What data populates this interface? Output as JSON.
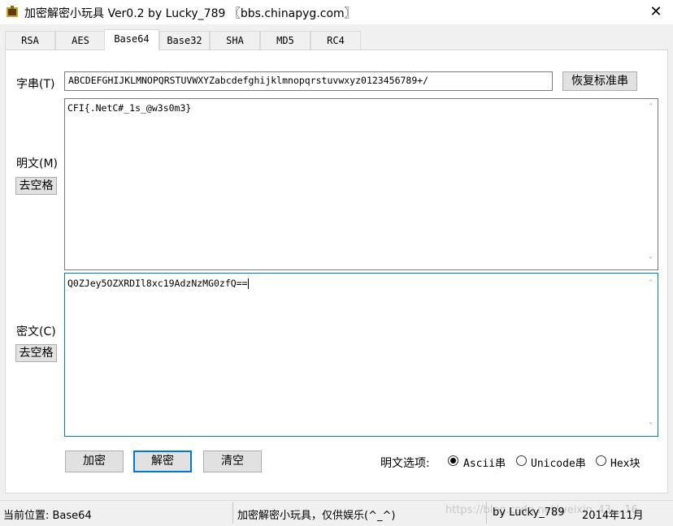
{
  "window": {
    "title": "加密解密小玩具 Ver0.2 by Lucky_789 〖bbs.chinapyg.com〗",
    "close_glyph": "✕"
  },
  "tabs": [
    {
      "label": "RSA"
    },
    {
      "label": "AES"
    },
    {
      "label": "Base64",
      "active": true
    },
    {
      "label": "Base32"
    },
    {
      "label": "SHA"
    },
    {
      "label": "MD5"
    },
    {
      "label": "RC4"
    }
  ],
  "charset": {
    "label": "字串(T)",
    "value": "ABCDEFGHIJKLMNOPQRSTUVWXYZabcdefghijklmnopqrstuvwxyz0123456789+/",
    "restore_button": "恢复标准串"
  },
  "plaintext": {
    "label": "明文(M)",
    "strip_button": "去空格",
    "value": "CFI{.NetC#_1s_@w3s0m3}"
  },
  "ciphertext": {
    "label": "密文(C)",
    "strip_button": "去空格",
    "value": "Q0ZJey5OZXRDIl8xc19AdzNzMG0zfQ=="
  },
  "actions": {
    "encrypt": "加密",
    "decrypt": "解密",
    "clear": "清空"
  },
  "options": {
    "label": "明文选项:",
    "items": [
      "Ascii串",
      "Unicode串",
      "Hex块"
    ],
    "selected": "Ascii串"
  },
  "status": {
    "position": "当前位置: Base64",
    "message": "加密解密小玩具，仅供娱乐(^_^)",
    "author": "by Lucky_789",
    "date": "2014年11月",
    "watermark": "https://blog.csdn.net/weixin_43... 16"
  }
}
